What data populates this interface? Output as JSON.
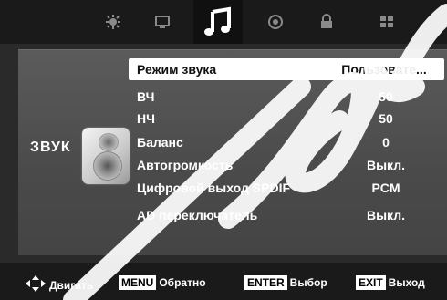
{
  "tabs": [
    {
      "name": "picture",
      "icon": "picture-icon",
      "active": false
    },
    {
      "name": "screen",
      "icon": "screen-icon",
      "active": false
    },
    {
      "name": "sound",
      "icon": "music-note-icon",
      "active": true
    },
    {
      "name": "time",
      "icon": "clock-icon",
      "active": false
    },
    {
      "name": "lock",
      "icon": "lock-icon",
      "active": false
    },
    {
      "name": "setup",
      "icon": "setup-grid-icon",
      "active": false
    }
  ],
  "section": {
    "label": "ЗВУК",
    "icon": "speaker-icon"
  },
  "menu": {
    "items": [
      {
        "label": "Режим звука",
        "value": "Пользовате...",
        "selected": true
      },
      {
        "label": "ВЧ",
        "value": "50",
        "selected": false
      },
      {
        "label": "НЧ",
        "value": "50",
        "selected": false
      },
      {
        "label": "Баланс",
        "value": "0",
        "selected": false
      },
      {
        "label": "Автогромкость",
        "value": "Выкл.",
        "selected": false
      },
      {
        "label": "Цифровой выход SPDIF",
        "value": "PCM",
        "selected": false
      },
      {
        "label": "AD переключатель",
        "value": "Выкл.",
        "selected": false
      }
    ]
  },
  "help": {
    "move": {
      "icon": "arrows-icon",
      "label": "Двигать"
    },
    "menu": {
      "key": "MENU",
      "label": "Обратно"
    },
    "enter": {
      "key": "ENTER",
      "label": "Выбор"
    },
    "exit": {
      "key": "EXIT",
      "label": "Выход"
    }
  },
  "colors": {
    "osd_bg": "#2a2a2a",
    "panel": "#4a4a4a",
    "highlight": "#ffffff",
    "watermark": "#ffffff"
  }
}
